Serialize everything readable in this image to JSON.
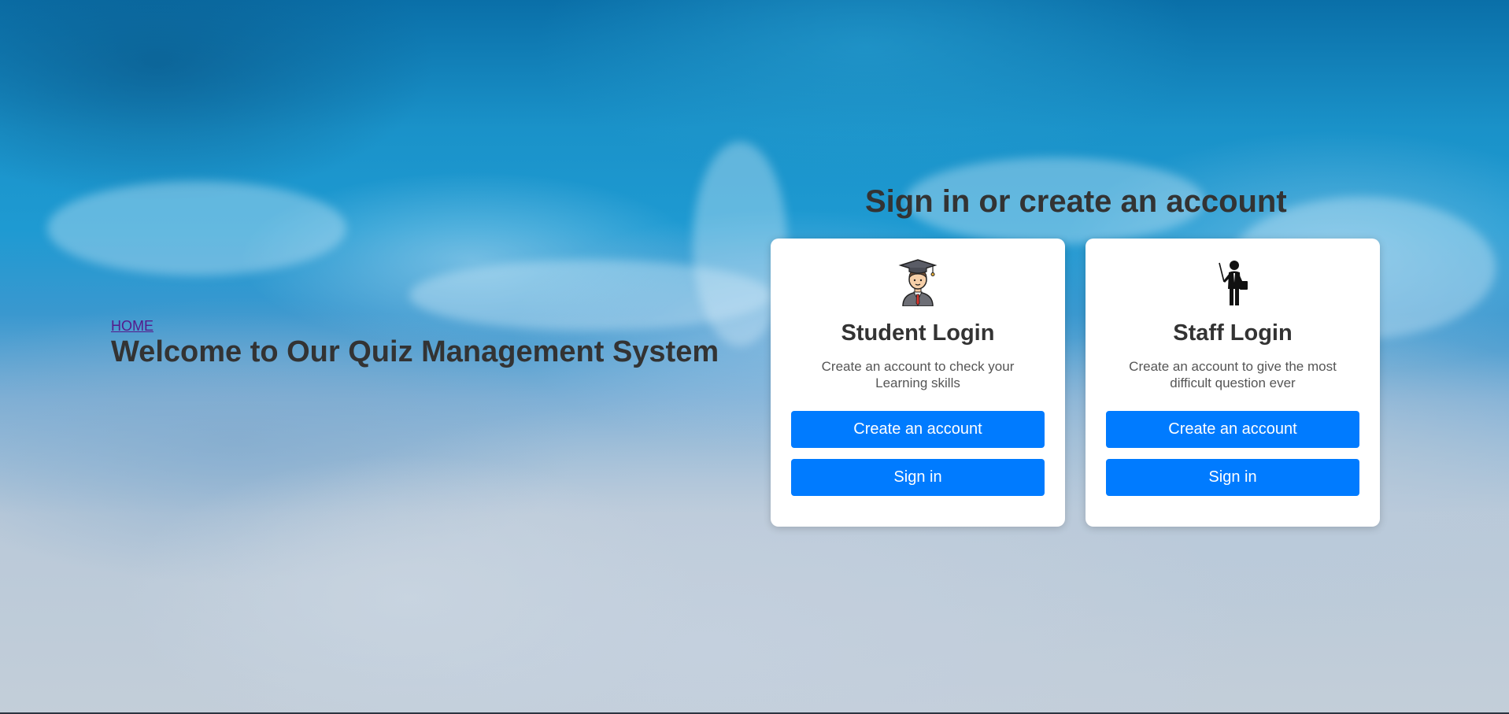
{
  "hero": {
    "home_link": "HOME",
    "title": "Welcome to Our Quiz Management System"
  },
  "auth_section": {
    "title": "Sign in or create an account"
  },
  "cards": [
    {
      "icon": "graduate-student-icon",
      "title": "Student Login",
      "description": "Create an account to check your Learning skills",
      "create_label": "Create an account",
      "signin_label": "Sign in"
    },
    {
      "icon": "teacher-pointer-icon",
      "title": "Staff Login",
      "description": "Create an account to give the most difficult question ever",
      "create_label": "Create an account",
      "signin_label": "Sign in"
    }
  ],
  "colors": {
    "primary_button": "#007bff",
    "heading": "#333333",
    "link_visited": "#551a8b"
  }
}
